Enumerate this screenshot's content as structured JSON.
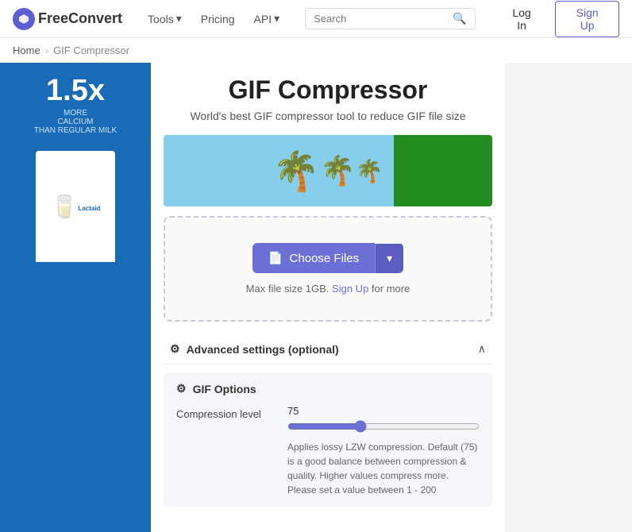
{
  "navbar": {
    "logo_text": "FreeConvert",
    "links": [
      {
        "label": "Tools",
        "has_arrow": true
      },
      {
        "label": "Pricing",
        "has_arrow": false
      },
      {
        "label": "API",
        "has_arrow": true
      }
    ],
    "search_placeholder": "Search",
    "login_label": "Log In",
    "signup_label": "Sign Up"
  },
  "breadcrumb": {
    "home": "Home",
    "current": "GIF Compressor"
  },
  "hero": {
    "title": "GIF Compressor",
    "subtitle": "World's best GIF compressor tool to reduce GIF file size"
  },
  "upload": {
    "choose_files_label": "Choose Files",
    "max_file_note_prefix": "Max file size 1GB.",
    "sign_up_label": "Sign Up",
    "max_file_note_suffix": " for more"
  },
  "advanced": {
    "label": "Advanced settings (optional)",
    "gif_options_label": "GIF Options",
    "compression": {
      "label": "Compression level",
      "value": "75",
      "fill_percent": 37.5,
      "description": "Applies lossy LZW compression. Default (75) is a good balance between compression & quality. Higher values compress more. Please set a value between 1 - 200"
    }
  },
  "icons": {
    "logo": "⬡",
    "search": "🔍",
    "chevron_down": "▾",
    "chevron_up": "∧",
    "gear": "⚙",
    "file": "📄"
  }
}
